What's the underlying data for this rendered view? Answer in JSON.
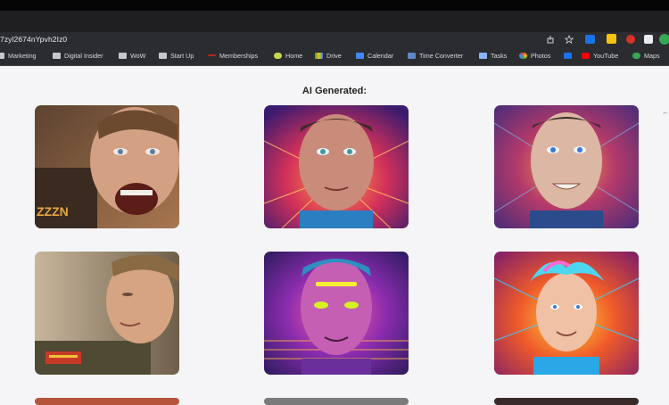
{
  "browser": {
    "url": "7zyl2674nYpvh2Iz0",
    "bookmarks": [
      {
        "label": "Marketing",
        "icon": "folder-icon"
      },
      {
        "label": "Digital Insider",
        "icon": "folder-icon"
      },
      {
        "label": "WoW",
        "icon": "folder-icon"
      },
      {
        "label": "Start Up",
        "icon": "folder-icon"
      },
      {
        "label": "Memberships",
        "icon": "memberships-icon"
      },
      {
        "label": "Home",
        "icon": "home-icon"
      },
      {
        "label": "Drive",
        "icon": "drive-icon"
      },
      {
        "label": "Calendar",
        "icon": "calendar-icon"
      },
      {
        "label": "Time Converter",
        "icon": "time-converter-icon"
      },
      {
        "label": "Tasks",
        "icon": "tasks-icon"
      },
      {
        "label": "Photos",
        "icon": "photos-icon"
      },
      {
        "label": "",
        "icon": "meet-icon"
      },
      {
        "label": "YouTube",
        "icon": "youtube-icon"
      },
      {
        "label": "Maps",
        "icon": "maps-icon"
      }
    ]
  },
  "content": {
    "heading": "AI Generated:",
    "images": [
      {
        "alt": "realistic man shouting portrait",
        "bg": "#7a5a3c",
        "skin": "#d19a7c"
      },
      {
        "alt": "neon synthwave portrait",
        "bg": "#7a2b59",
        "skin": "#c98b7a"
      },
      {
        "alt": "psychedelic colorful portrait",
        "bg": "#5d3b74",
        "skin": "#d7b2a0"
      },
      {
        "alt": "man in pilot jacket side view",
        "bg": "#9d8d76",
        "skin": "#d5a07e"
      },
      {
        "alt": "purple neon portrait with glowing eyes",
        "bg": "#5f2c8b",
        "skin": "#c25fb0"
      },
      {
        "alt": "rainbow hair cartoon portrait",
        "bg": "#e06631",
        "skin": "#f0c1a4"
      }
    ]
  }
}
